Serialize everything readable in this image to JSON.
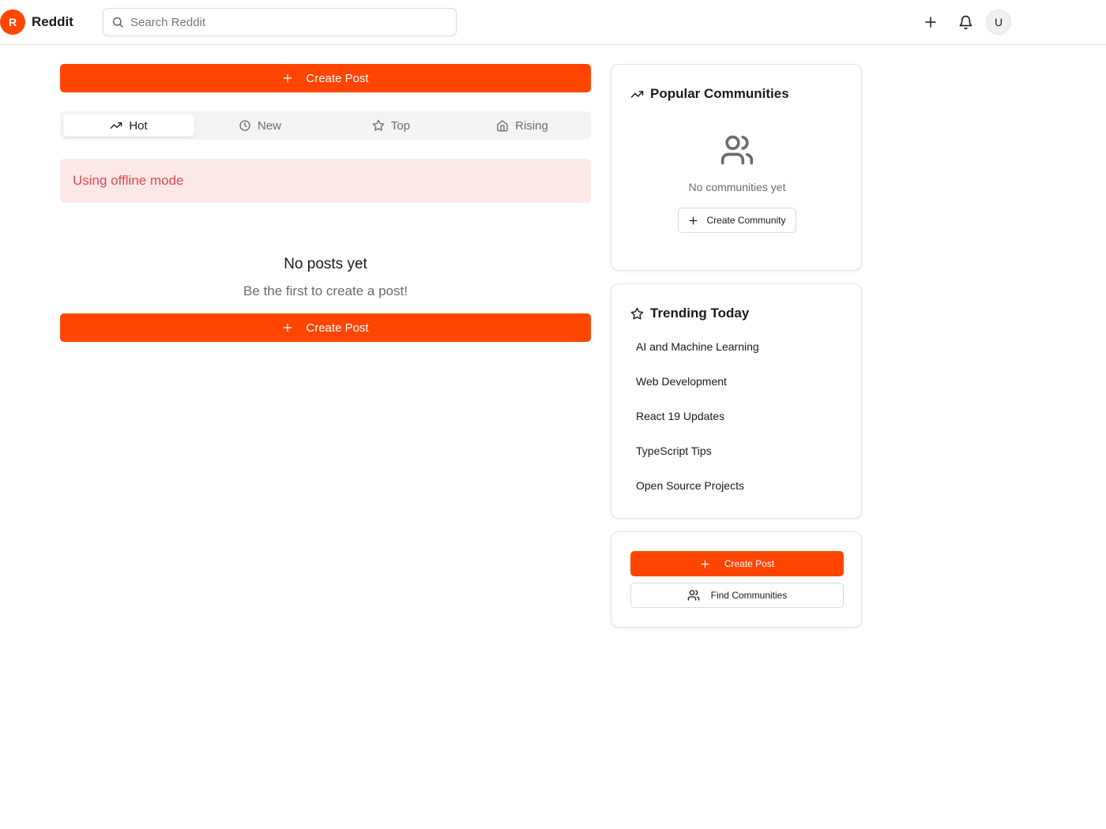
{
  "header": {
    "logo_letter": "R",
    "brand": "Reddit",
    "search_placeholder": "Search Reddit",
    "avatar_initial": "U"
  },
  "feed": {
    "create_post_label": "Create Post",
    "tabs": [
      {
        "label": "Hot",
        "icon": "trending-up-icon",
        "active": true
      },
      {
        "label": "New",
        "icon": "clock-icon",
        "active": false
      },
      {
        "label": "Top",
        "icon": "star-icon",
        "active": false
      },
      {
        "label": "Rising",
        "icon": "home-icon",
        "active": false
      }
    ],
    "offline_message": "Using offline mode",
    "empty_title": "No posts yet",
    "empty_subtitle": "Be the first to create a post!"
  },
  "sidebar": {
    "popular": {
      "title": "Popular Communities",
      "empty_text": "No communities yet",
      "create_label": "Create Community"
    },
    "trending": {
      "title": "Trending Today",
      "items": [
        "AI and Machine Learning",
        "Web Development",
        "React 19 Updates",
        "TypeScript Tips",
        "Open Source Projects"
      ]
    },
    "actions": {
      "create_post_label": "Create Post",
      "find_communities_label": "Find Communities"
    }
  },
  "colors": {
    "accent": "#ff4500",
    "offline_bg": "#fde8e8",
    "offline_text": "#e0484e"
  }
}
